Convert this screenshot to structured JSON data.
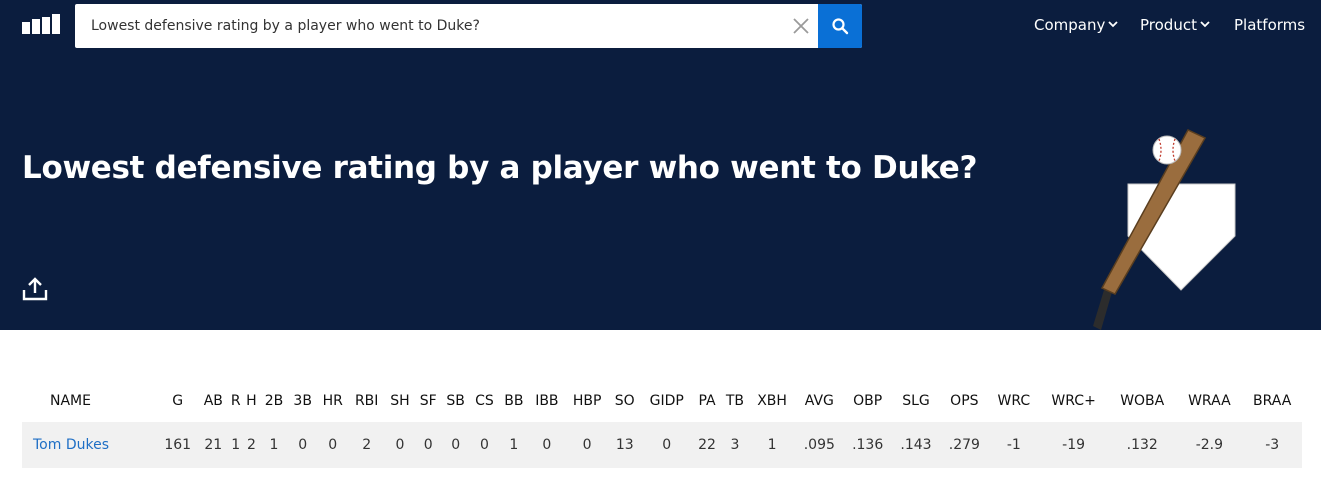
{
  "search": {
    "value": "Lowest defensive rating by a player who went to Duke?"
  },
  "nav": {
    "company": "Company",
    "product": "Product",
    "platforms": "Platforms"
  },
  "hero": {
    "title": "Lowest defensive rating by a player who went to Duke?"
  },
  "icons": [
    "logo-icon",
    "clear-icon",
    "search-icon",
    "chevron-down-icon",
    "share-icon",
    "baseball-bat-illustration"
  ],
  "colors": {
    "hero_bg": "#0b1d3e",
    "accent": "#0a70d6",
    "link": "#1f6fc5",
    "row_bg": "#f1f1f1"
  },
  "table": {
    "columns": [
      "NAME",
      "G",
      "AB",
      "R",
      "H",
      "2B",
      "3B",
      "HR",
      "RBI",
      "SH",
      "SF",
      "SB",
      "CS",
      "BB",
      "IBB",
      "HBP",
      "SO",
      "GIDP",
      "PA",
      "TB",
      "XBH",
      "AVG",
      "OBP",
      "SLG",
      "OPS",
      "WRC",
      "WRC+",
      "WOBA",
      "WRAA",
      "BRAA"
    ],
    "rows": [
      [
        "Tom Dukes",
        "161",
        "21",
        "1",
        "2",
        "1",
        "0",
        "0",
        "2",
        "0",
        "0",
        "0",
        "0",
        "1",
        "0",
        "0",
        "13",
        "0",
        "22",
        "3",
        "1",
        ".095",
        ".136",
        ".143",
        ".279",
        "-1",
        "-19",
        ".132",
        "-2.9",
        "-3"
      ]
    ]
  }
}
